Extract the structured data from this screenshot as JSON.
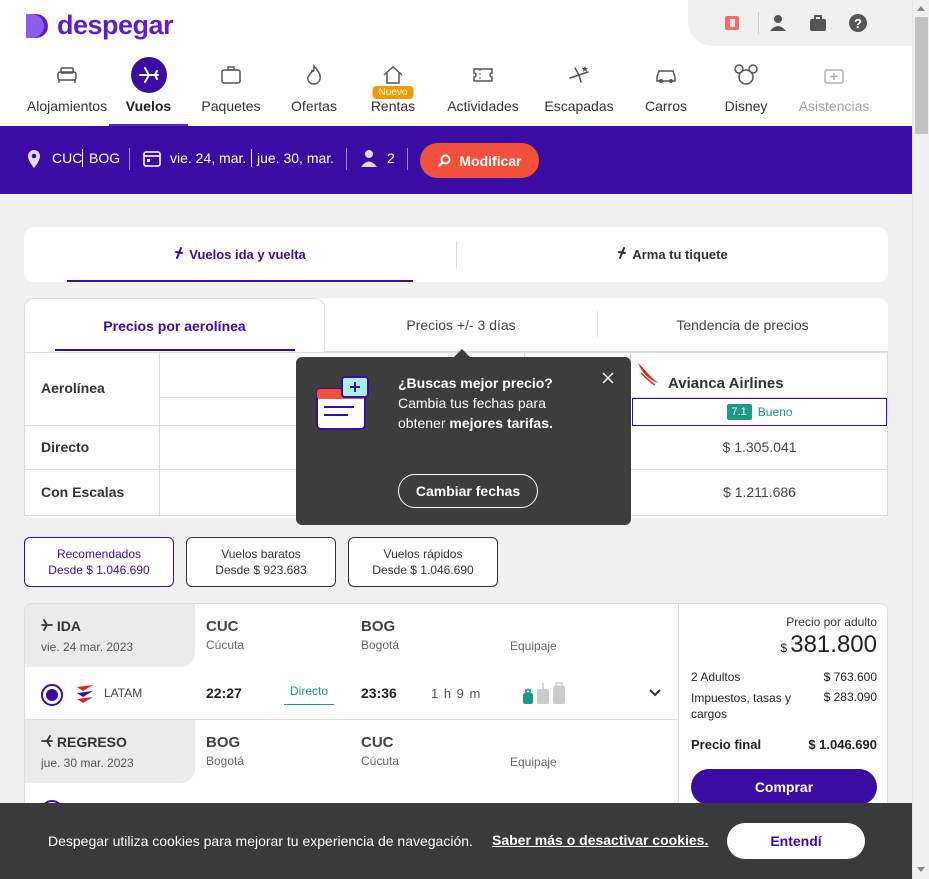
{
  "brand": {
    "name": "despegar",
    "color": "#5c1fcf",
    "secondary": "#3a0ca3",
    "accent": "#f2503b"
  },
  "topbar": {
    "icons": [
      "gift-icon",
      "user-icon",
      "briefcase-icon",
      "help-icon"
    ]
  },
  "nav": {
    "items": [
      {
        "label": "Alojamientos",
        "icon": "bed-icon"
      },
      {
        "label": "Vuelos",
        "icon": "plane-icon",
        "active": true
      },
      {
        "label": "Paquetes",
        "icon": "suitcase-icon"
      },
      {
        "label": "Ofertas",
        "icon": "flame-icon"
      },
      {
        "label": "Rentas",
        "icon": "house-icon",
        "badge": "Nuevo"
      },
      {
        "label": "Actividades",
        "icon": "ticket-icon"
      },
      {
        "label": "Escapadas",
        "icon": "plane-star-icon"
      },
      {
        "label": "Carros",
        "icon": "car-icon"
      },
      {
        "label": "Disney",
        "icon": "mickey-icon"
      },
      {
        "label": "Asistencias",
        "icon": "first-aid-icon"
      }
    ]
  },
  "search": {
    "origin": "CUC",
    "destination": "BOG",
    "depart": "vie. 24, mar.",
    "return": "jue. 30, mar.",
    "passengers": "2",
    "modify_label": "Modificar"
  },
  "trip_types": {
    "round": "Vuelos ida y vuelta",
    "build": "Arma tu tiquete"
  },
  "price_tabs": {
    "airline": "Precios por aerolínea",
    "days": "Precios +/- 3 días",
    "trend": "Tendencia de precios"
  },
  "price_grid": {
    "row_airline": "Aerolínea",
    "row_direct": "Directo",
    "row_stops": "Con Escalas",
    "airline": "Avianca Airlines",
    "score": "7.1",
    "score_label": "Bueno",
    "direct_price": "$ 1.305.041",
    "stops_price": "$ 1.211.686"
  },
  "tooltip": {
    "bold1": "¿Buscas mejor precio?",
    "text": "Cambia tus fechas para obtener",
    "bold2": "mejores tarifas.",
    "button": "Cambiar fechas"
  },
  "filters": [
    {
      "title": "Recomendados",
      "sub": "Desde $ 1.046.690",
      "active": true
    },
    {
      "title": "Vuelos baratos",
      "sub": "Desde $ 923.683"
    },
    {
      "title": "Vuelos rápidos",
      "sub": "Desde $ 1.046.690"
    }
  ],
  "result": {
    "outbound": {
      "tag": "IDA",
      "date": "vie. 24 mar. 2023",
      "from_code": "CUC",
      "from_city": "Cúcuta",
      "to_code": "BOG",
      "to_city": "Bogotá",
      "baggage": "Equipaje",
      "airline": "LATAM",
      "dep": "22:27",
      "stops": "Directo",
      "arr": "23:36",
      "duration": "1 h 9 m"
    },
    "return": {
      "tag": "REGRESO",
      "date": "jue. 30 mar. 2023",
      "from_code": "BOG",
      "from_city": "Bogotá",
      "to_code": "CUC",
      "to_city": "Cúcuta",
      "baggage": "Equipaje"
    },
    "price": {
      "per_adult_label": "Precio por adulto",
      "currency": "$",
      "per_adult": "381.800",
      "adults_label": "2 Adultos",
      "adults_value": "$ 763.600",
      "taxes_label": "Impuestos, tasas y cargos",
      "taxes_value": "$ 283.090",
      "final_label": "Precio final",
      "final_value": "$ 1.046.690",
      "buy_label": "Comprar"
    }
  },
  "cookie": {
    "text": "Despegar utiliza cookies para mejorar tu experiencia de navegación.",
    "link": "Saber más o desactivar cookies.",
    "button": "Entendí"
  }
}
